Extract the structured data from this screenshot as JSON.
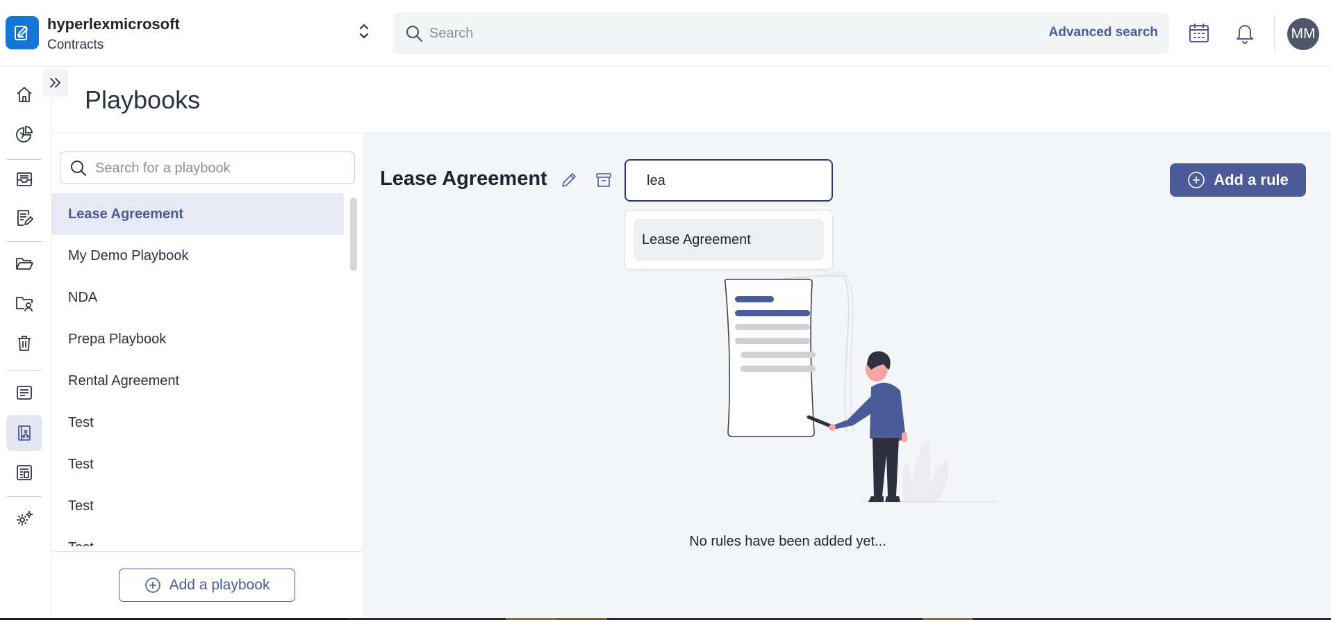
{
  "header": {
    "org_name": "hyperlexmicrosoft",
    "app_name": "Contracts",
    "search_placeholder": "Search",
    "advanced_search_label": "Advanced search",
    "avatar_initials": "MM"
  },
  "rail": {
    "items": [
      {
        "icon": "home-icon"
      },
      {
        "icon": "analytics-icon"
      },
      {
        "icon": "inbox-icon"
      },
      {
        "icon": "contract-edit-icon"
      },
      {
        "icon": "folder-icon"
      },
      {
        "icon": "shared-folder-icon"
      },
      {
        "icon": "trash-icon"
      },
      {
        "icon": "clauses-icon"
      },
      {
        "icon": "playbook-icon",
        "active": true
      },
      {
        "icon": "templates-icon"
      },
      {
        "icon": "settings-icon"
      }
    ]
  },
  "page": {
    "title": "Playbooks"
  },
  "playbook_list": {
    "search_placeholder": "Search for a playbook",
    "items": [
      {
        "label": "Lease Agreement",
        "active": true
      },
      {
        "label": "My Demo Playbook"
      },
      {
        "label": "NDA"
      },
      {
        "label": "Prepa Playbook"
      },
      {
        "label": "Rental Agreement"
      },
      {
        "label": "Test"
      },
      {
        "label": "Test"
      },
      {
        "label": "Test"
      },
      {
        "label": "Test"
      }
    ],
    "add_label": "Add a playbook"
  },
  "main": {
    "playbook_title": "Lease Agreement",
    "rule_search_value": "lea",
    "suggestions": [
      "Lease Agreement"
    ],
    "add_rule_label": "Add a rule",
    "empty_message": "No rules have been added yet..."
  },
  "colors": {
    "accent": "#4a5b97",
    "logo": "#1477d4",
    "selected_bg": "#e7e9f4",
    "main_bg": "#f4f5f8"
  }
}
